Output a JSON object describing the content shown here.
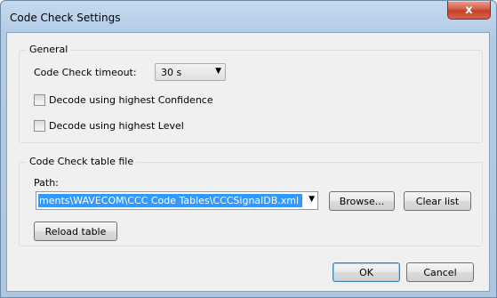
{
  "window": {
    "title": "Code Check Settings",
    "close_symbol": "x"
  },
  "general": {
    "legend": "General",
    "timeout_label": "Code Check timeout:",
    "timeout_value": "30 s",
    "checkbox_confidence": {
      "label": "Decode using highest Confidence",
      "checked": false
    },
    "checkbox_level": {
      "label": "Decode using highest Level",
      "checked": false
    }
  },
  "table_file": {
    "legend": "Code Check table file",
    "path_label": "Path:",
    "path_value": "ments\\WAVECOM\\CCC Code Tables\\CCCSignalDB.xml",
    "browse_label": "Browse...",
    "clear_label": "Clear list",
    "reload_label": "Reload table"
  },
  "footer": {
    "ok_label": "OK",
    "cancel_label": "Cancel"
  }
}
